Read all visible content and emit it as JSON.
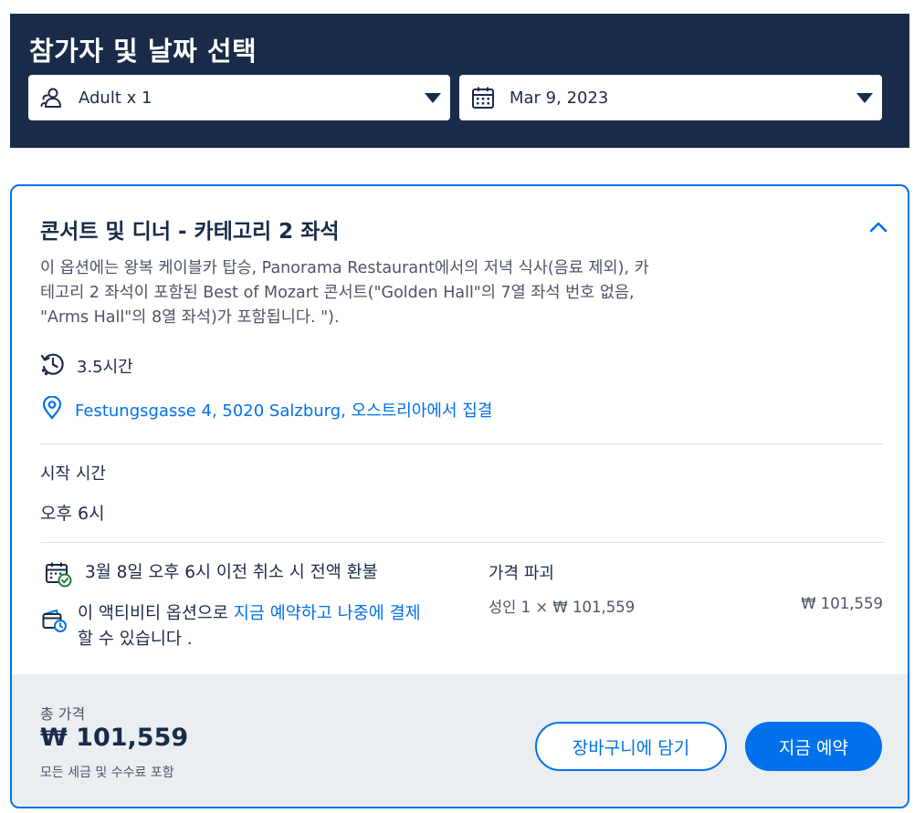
{
  "header": {
    "title": "참가자 및 날짜 선택",
    "participants": "Adult x 1",
    "date": "Mar 9, 2023"
  },
  "option": {
    "title": "콘서트 및 디너 - 카테고리 2 좌석",
    "description": "이 옵션에는 왕복 케이블카 탑승, Panorama Restaurant에서의 저녁 식사(음료 제외), 카테고리 2 좌석이 포함된 Best of Mozart 콘서트(\"Golden Hall\"의 7열 좌석 번호 없음, \"Arms Hall\"의 8열 좌석)가 포함됩니다. \").",
    "duration": "3.5시간",
    "meeting_point": "Festungsgasse 4, 5020 Salzburg, 오스트리아에서 집결",
    "start_time_label": "시작 시간",
    "start_time_value": "오후 6시",
    "cancellation": "3월 8일 오후 6시 이전 취소 시 전액 환불",
    "reserve": {
      "prefix": "이 액티비티 옵션으로 ",
      "link": "지금 예약하고 나중에 결제",
      "suffix": " 할 수 있습니다 ."
    }
  },
  "price_breakdown": {
    "title": "가격 파괴",
    "line_label": "성인  1 × ₩ 101,559",
    "line_total": "₩ 101,559"
  },
  "footer": {
    "total_label": "총 가격",
    "total_value": "₩ 101,559",
    "note": "모든 세금 및 수수료 포함",
    "cart_button": "장바구니에 담기",
    "book_button": "지금 예약"
  },
  "colors": {
    "navy": "#1a2b49",
    "accent": "#0071eb",
    "footer_bg": "#ebeef1"
  },
  "icons": {
    "participants": "people-icon",
    "date": "calendar-icon",
    "duration": "clock-history-icon",
    "meeting": "location-pin-icon",
    "cancellation": "calendar-check-icon",
    "reserve": "wallet-clock-icon",
    "collapse": "chevron-up-icon"
  }
}
